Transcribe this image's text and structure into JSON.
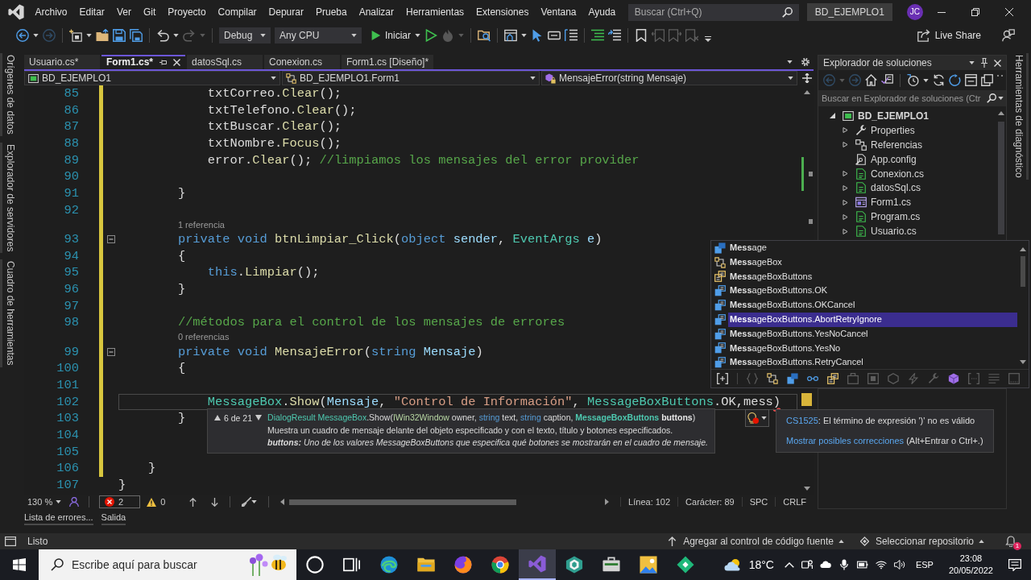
{
  "menu_bar": {
    "items": [
      "Archivo",
      "Editar",
      "Ver",
      "Git",
      "Proyecto",
      "Compilar",
      "Depurar",
      "Prueba",
      "Analizar",
      "Herramientas",
      "Extensiones",
      "Ventana",
      "Ayuda"
    ],
    "search": {
      "placeholder": "Buscar (Ctrl+Q)"
    },
    "solution_name": "BD_EJEMPLO1",
    "avatar_initials": "JC"
  },
  "toolbar": {
    "groups": [
      [
        {
          "kind": "back",
          "disabled": false
        },
        {
          "kind": "forward",
          "disabled": true
        }
      ],
      [
        {
          "kind": "new_item",
          "disabled": false
        },
        {
          "kind": "open",
          "disabled": false
        },
        {
          "kind": "save",
          "disabled": false
        },
        {
          "kind": "save_all",
          "disabled": false
        }
      ],
      [
        {
          "kind": "undo",
          "disabled": false
        },
        {
          "kind": "redo",
          "disabled": true
        }
      ],
      [
        {
          "kind": "configuration",
          "label": "Debug",
          "disabled": false
        },
        {
          "kind": "platform",
          "label": "Any CPU",
          "disabled": false
        },
        {
          "kind": "start",
          "label": "Iniciar",
          "disabled": false
        },
        {
          "kind": "run_without_debugging",
          "disabled": false
        },
        {
          "kind": "hot_reload",
          "disabled": true
        }
      ],
      [
        {
          "kind": "find_in_files",
          "disabled": false
        }
      ],
      [
        {
          "kind": "window_layout",
          "disabled": false
        },
        {
          "kind": "pointer",
          "disabled": false
        },
        {
          "kind": "shape",
          "disabled": false
        },
        {
          "kind": "indent",
          "disabled": false
        }
      ],
      [
        {
          "kind": "comment",
          "disabled": false
        },
        {
          "kind": "uncomment",
          "disabled": false
        }
      ],
      [
        {
          "kind": "bookmark",
          "disabled": false
        },
        {
          "kind": "bookmark_previous",
          "disabled": true
        },
        {
          "kind": "bookmark_next",
          "disabled": true
        },
        {
          "kind": "bookmark_clear",
          "disabled": true
        }
      ]
    ],
    "live_share": "Live Share"
  },
  "left_side_tabs": [
    "Orígenes de datos",
    "Explorador de servidores",
    "Cuadro de herramientas"
  ],
  "document_tabs": [
    {
      "label": "Usuario.cs*",
      "selected": false
    },
    {
      "label": "Form1.cs*",
      "selected": true
    },
    {
      "label": "datosSql.cs",
      "selected": false
    },
    {
      "label": "Conexion.cs",
      "selected": false
    },
    {
      "label": "Form1.cs [Diseño]*",
      "selected": false
    }
  ],
  "navigation_bar": {
    "project": "BD_EJEMPLO1",
    "type": "BD_EJEMPLO1.Form1",
    "member": "MensajeError(string Mensaje)"
  },
  "editor": {
    "lines": [
      {
        "number": "85",
        "modified": true,
        "fold": false,
        "current": false,
        "code": [
          {
            "kind": "plain",
            "text": "            txtCorreo."
          },
          {
            "kind": "method",
            "text": "Clear"
          },
          {
            "kind": "plain",
            "text": "();"
          }
        ]
      },
      {
        "number": "86",
        "modified": true,
        "fold": false,
        "current": false,
        "code": [
          {
            "kind": "plain",
            "text": "            txtTelefono."
          },
          {
            "kind": "method",
            "text": "Clear"
          },
          {
            "kind": "plain",
            "text": "();"
          }
        ]
      },
      {
        "number": "87",
        "modified": true,
        "fold": false,
        "current": false,
        "code": [
          {
            "kind": "plain",
            "text": "            txtBuscar."
          },
          {
            "kind": "method",
            "text": "Clear"
          },
          {
            "kind": "plain",
            "text": "();"
          }
        ]
      },
      {
        "number": "88",
        "modified": true,
        "fold": false,
        "current": false,
        "code": [
          {
            "kind": "plain",
            "text": "            txtNombre."
          },
          {
            "kind": "method",
            "text": "Focus"
          },
          {
            "kind": "plain",
            "text": "();"
          }
        ]
      },
      {
        "number": "89",
        "modified": true,
        "fold": false,
        "current": false,
        "code": [
          {
            "kind": "plain",
            "text": "            error."
          },
          {
            "kind": "method",
            "text": "Clear"
          },
          {
            "kind": "plain",
            "text": "(); "
          },
          {
            "kind": "comment",
            "text": "//limpiamos los mensajes del error provider"
          }
        ]
      },
      {
        "number": "90",
        "modified": true,
        "fold": false,
        "current": false
      },
      {
        "number": "91",
        "modified": true,
        "fold": false,
        "current": false,
        "code": [
          {
            "kind": "plain",
            "text": "        }"
          }
        ]
      },
      {
        "number": "92",
        "modified": true,
        "fold": false,
        "current": false
      },
      {
        "number": "93",
        "codelens": "1 referencia",
        "modified": true,
        "fold": true,
        "current": false,
        "code": [
          {
            "kind": "keyword",
            "text": "        private void "
          },
          {
            "kind": "method",
            "text": "btnLimpiar_Click"
          },
          {
            "kind": "plain",
            "text": "("
          },
          {
            "kind": "keyword",
            "text": "object "
          },
          {
            "kind": "param",
            "text": "sender"
          },
          {
            "kind": "plain",
            "text": ", "
          },
          {
            "kind": "type",
            "text": "EventArgs "
          },
          {
            "kind": "param",
            "text": "e"
          },
          {
            "kind": "plain",
            "text": ")"
          }
        ]
      },
      {
        "number": "94",
        "modified": true,
        "fold": false,
        "current": false,
        "code": [
          {
            "kind": "plain",
            "text": "        {"
          }
        ]
      },
      {
        "number": "95",
        "modified": true,
        "fold": false,
        "current": false,
        "code": [
          {
            "kind": "keyword",
            "text": "            this"
          },
          {
            "kind": "plain",
            "text": "."
          },
          {
            "kind": "method",
            "text": "Limpiar"
          },
          {
            "kind": "plain",
            "text": "();"
          }
        ]
      },
      {
        "number": "96",
        "modified": true,
        "fold": false,
        "current": false,
        "code": [
          {
            "kind": "plain",
            "text": "        }"
          }
        ]
      },
      {
        "number": "97",
        "modified": true,
        "fold": false,
        "current": false
      },
      {
        "number": "98",
        "modified": true,
        "fold": false,
        "current": false,
        "code": [
          {
            "kind": "comment",
            "text": "        //métodos para el control de los mensajes de errores"
          }
        ]
      },
      {
        "number": "99",
        "codelens": "0 referencias",
        "modified": true,
        "fold": true,
        "current": false,
        "code": [
          {
            "kind": "keyword",
            "text": "        private void "
          },
          {
            "kind": "method",
            "text": "MensajeError"
          },
          {
            "kind": "plain",
            "text": "("
          },
          {
            "kind": "keyword",
            "text": "string "
          },
          {
            "kind": "param",
            "text": "Mensaje"
          },
          {
            "kind": "plain",
            "text": ")"
          }
        ]
      },
      {
        "number": "100",
        "modified": true,
        "fold": false,
        "current": false,
        "code": [
          {
            "kind": "plain",
            "text": "        {"
          }
        ]
      },
      {
        "number": "101",
        "modified": true,
        "fold": false,
        "current": false
      },
      {
        "number": "102",
        "modified": true,
        "fold": false,
        "current": true,
        "code": [
          {
            "kind": "type",
            "text": "            MessageBox"
          },
          {
            "kind": "plain",
            "text": "."
          },
          {
            "kind": "method",
            "text": "Show"
          },
          {
            "kind": "plain",
            "text": "("
          },
          {
            "kind": "param",
            "text": "Mensaje"
          },
          {
            "kind": "plain",
            "text": ", "
          },
          {
            "kind": "string",
            "text": "\"Control de Información\""
          },
          {
            "kind": "plain",
            "text": ", "
          },
          {
            "kind": "type",
            "text": "MessageBoxButtons"
          },
          {
            "kind": "plain",
            "text": ".OK,mess"
          },
          {
            "kind": "error",
            "text": ")"
          }
        ]
      },
      {
        "number": "103",
        "modified": true,
        "fold": false,
        "current": false,
        "code": [
          {
            "kind": "plain",
            "text": "        }"
          }
        ]
      },
      {
        "number": "104",
        "modified": true,
        "fold": false,
        "current": false
      },
      {
        "number": "105",
        "modified": true,
        "fold": false,
        "current": false
      },
      {
        "number": "106",
        "modified": true,
        "fold": false,
        "current": false,
        "code": [
          {
            "kind": "plain",
            "text": "    }"
          }
        ]
      },
      {
        "number": "107",
        "modified": false,
        "fold": false,
        "current": false,
        "code": [
          {
            "kind": "plain",
            "text": "}"
          }
        ]
      }
    ]
  },
  "signature_help": {
    "overload": "6 de 21",
    "signature": [
      {
        "kind": "type",
        "text": "DialogResult "
      },
      {
        "kind": "type",
        "text": "MessageBox"
      },
      {
        "kind": "plain",
        "text": ".Show("
      },
      {
        "kind": "interface",
        "text": "IWin32Window "
      },
      {
        "kind": "plain",
        "text": "owner, "
      },
      {
        "kind": "keyword",
        "text": "string "
      },
      {
        "kind": "plain",
        "text": "text, "
      },
      {
        "kind": "keyword",
        "text": "string "
      },
      {
        "kind": "plain",
        "text": "caption, "
      },
      {
        "kind": "active_type",
        "text": "MessageBoxButtons "
      },
      {
        "kind": "active",
        "text": "buttons"
      },
      {
        "kind": "plain",
        "text": ")"
      }
    ],
    "summary": "Muestra un cuadro de mensaje delante del objeto especificado y con el texto, título y botones especificados.",
    "parameter_doc": "**buttons:** Uno de los valores MessageBoxButtons que especifica qué botones se mostrarán en el cuadro de mensaje."
  },
  "error_tooltip": {
    "code": "CS1525",
    "message": ": El término de expresión ')' no es válido",
    "fix_link": "Mostrar posibles correcciones",
    "shortcut": "(Alt+Entrar o Ctrl+.)"
  },
  "editor_status": {
    "zoom": "130 %",
    "errors": "2",
    "warnings": "0",
    "line": "Línea: 102",
    "column": "Carácter: 89",
    "whitespace": "SPC",
    "line_ending": "CRLF"
  },
  "bottom_tabs": [
    "Lista de errores...",
    "Salida"
  ],
  "solution_explorer": {
    "title": "Explorador de soluciones",
    "toolbar": [
      [
        {
          "kind": "back",
          "disabled": true
        },
        {
          "kind": "forward",
          "disabled": true
        },
        {
          "kind": "home",
          "disabled": false
        },
        {
          "kind": "switch_views",
          "disabled": false
        }
      ],
      [
        {
          "kind": "history",
          "disabled": false
        },
        {
          "kind": "sync",
          "disabled": false
        },
        {
          "kind": "refresh",
          "disabled": false
        },
        {
          "kind": "collapse_all",
          "disabled": false
        },
        {
          "kind": "copy",
          "disabled": false
        }
      ]
    ],
    "search": {
      "placeholder": "Buscar en Explorador de soluciones (Ctr"
    },
    "tree": [
      {
        "label": "BD_EJEMPLO1",
        "kind": "project",
        "expanded": true,
        "children": [
          {
            "label": "Properties",
            "kind": "properties",
            "expanded": false
          },
          {
            "label": "Referencias",
            "kind": "references",
            "expanded": false
          },
          {
            "label": "App.config",
            "kind": "config"
          },
          {
            "label": "Conexion.cs",
            "kind": "code_file",
            "expanded": false
          },
          {
            "label": "datosSql.cs",
            "kind": "code_file",
            "expanded": false
          },
          {
            "label": "Form1.cs",
            "kind": "form",
            "expanded": false
          },
          {
            "label": "Program.cs",
            "kind": "code_file",
            "expanded": false
          },
          {
            "label": "Usuario.cs",
            "kind": "code_file",
            "expanded": false
          }
        ]
      }
    ]
  },
  "completion_list": {
    "items": [
      {
        "kind": "struct",
        "label": "**Mess**age",
        "selected": false
      },
      {
        "kind": "class",
        "label": "**Mess**ageBox",
        "selected": false
      },
      {
        "kind": "enum",
        "label": "**Mess**ageBoxButtons",
        "selected": false
      },
      {
        "kind": "enum_member",
        "label": "**Mess**ageBoxButtons.OK",
        "selected": false
      },
      {
        "kind": "enum_member",
        "label": "**Mess**ageBoxButtons.OKCancel",
        "selected": false
      },
      {
        "kind": "enum_member",
        "label": "**Mess**ageBoxButtons.AbortRetryIgnore",
        "selected": true
      },
      {
        "kind": "enum_member",
        "label": "**Mess**ageBoxButtons.YesNoCancel",
        "selected": false
      },
      {
        "kind": "enum_member",
        "label": "**Mess**ageBoxButtons.YesNo",
        "selected": false
      },
      {
        "kind": "enum_member",
        "label": "**Mess**ageBoxButtons.RetryCancel",
        "selected": false
      }
    ],
    "filters": [
      {
        "kind": "expand",
        "disabled": false
      },
      {
        "kind": "namespace",
        "disabled": true
      },
      {
        "kind": "class",
        "disabled": false
      },
      {
        "kind": "struct",
        "disabled": false
      },
      {
        "kind": "delegate",
        "disabled": false
      },
      {
        "kind": "enum",
        "disabled": false
      },
      {
        "kind": "module",
        "disabled": true
      },
      {
        "kind": "field_box",
        "disabled": true
      },
      {
        "kind": "object",
        "disabled": true
      },
      {
        "kind": "event",
        "disabled": true
      },
      {
        "kind": "property",
        "disabled": true
      },
      {
        "kind": "method",
        "disabled": false
      },
      {
        "kind": "snippet",
        "disabled": true
      },
      {
        "kind": "keyword",
        "disabled": true
      },
      {
        "kind": "target",
        "disabled": true
      }
    ]
  },
  "right_side_tabs": [
    "Herramientas de diagnóstico"
  ],
  "status_bar": {
    "message": "Listo",
    "source_control": "Agregar al control de código fuente",
    "repository": "Seleccionar repositorio",
    "notification_count": "1"
  },
  "taskbar": {
    "search": {
      "placeholder": "Escribe aquí para buscar"
    },
    "apps": [
      {
        "kind": "assistant",
        "selected": false
      },
      {
        "kind": "task_view",
        "selected": false
      },
      {
        "kind": "browser_wave",
        "selected": false
      },
      {
        "kind": "file_manager",
        "selected": false
      },
      {
        "kind": "browser_fox",
        "selected": false
      },
      {
        "kind": "browser_round",
        "selected": false
      },
      {
        "kind": "ide",
        "selected": true
      },
      {
        "kind": "cube_app",
        "selected": false
      },
      {
        "kind": "toolbox_app",
        "selected": false
      },
      {
        "kind": "image_app",
        "selected": false
      },
      {
        "kind": "green_app",
        "selected": false
      }
    ],
    "weather": "18°C",
    "language": "ESP",
    "time": "23:08",
    "date": "20/05/2022"
  }
}
